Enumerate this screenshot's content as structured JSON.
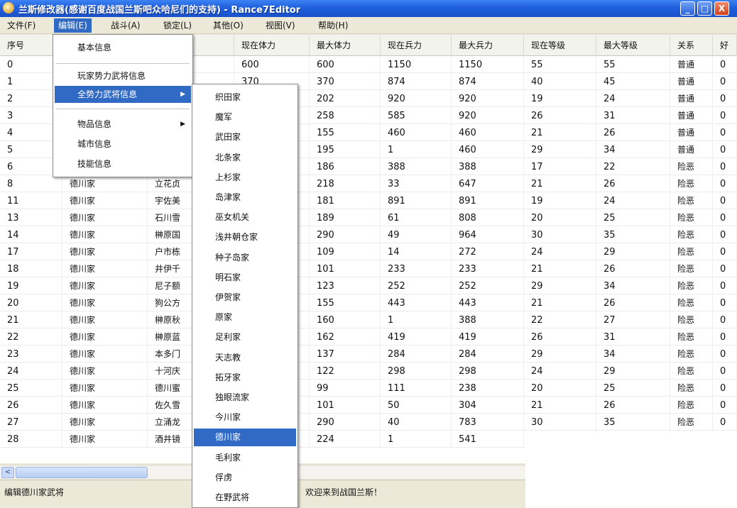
{
  "window": {
    "title": "兰斯修改器(感谢百度战国兰斯吧众哈尼们的支持) - Rance7Editor",
    "buttons": {
      "minimize": "_",
      "maximize": "□",
      "close": "X"
    }
  },
  "menubar": [
    "文件(F)",
    "编辑(E)",
    "战斗(A)",
    "锁定(L)",
    "其他(O)",
    "视图(V)",
    "帮助(H)"
  ],
  "table": {
    "headers": [
      "序号",
      "",
      "",
      "现在体力",
      "最大体力",
      "现在兵力",
      "最大兵力",
      "现在等级",
      "最大等级",
      "关系",
      "好"
    ],
    "rows": [
      [
        "0",
        "",
        "",
        "600",
        "600",
        "1150",
        "1150",
        "55",
        "55",
        "普通",
        "0"
      ],
      [
        "1",
        "",
        "",
        "370",
        "370",
        "874",
        "874",
        "40",
        "45",
        "普通",
        "0"
      ],
      [
        "2",
        "",
        "",
        "",
        "202",
        "920",
        "920",
        "19",
        "24",
        "普通",
        "0"
      ],
      [
        "3",
        "",
        "",
        "",
        "258",
        "585",
        "920",
        "26",
        "31",
        "普通",
        "0"
      ],
      [
        "4",
        "",
        "",
        "",
        "155",
        "460",
        "460",
        "21",
        "26",
        "普通",
        "0"
      ],
      [
        "5",
        "",
        "",
        "",
        "195",
        "1",
        "460",
        "29",
        "34",
        "普通",
        "0"
      ],
      [
        "6",
        "",
        "",
        "",
        "186",
        "388",
        "388",
        "17",
        "22",
        "险恶",
        "0"
      ],
      [
        "8",
        "德川家",
        "立花贞",
        "",
        "218",
        "33",
        "647",
        "21",
        "26",
        "险恶",
        "0"
      ],
      [
        "11",
        "德川家",
        "宇佐美",
        "",
        "181",
        "891",
        "891",
        "19",
        "24",
        "险恶",
        "0"
      ],
      [
        "13",
        "德川家",
        "石川雪",
        "",
        "189",
        "61",
        "808",
        "20",
        "25",
        "险恶",
        "0"
      ],
      [
        "14",
        "德川家",
        "榊原国",
        "",
        "290",
        "49",
        "964",
        "30",
        "35",
        "险恶",
        "0"
      ],
      [
        "17",
        "德川家",
        "户市栋",
        "",
        "109",
        "14",
        "272",
        "24",
        "29",
        "险恶",
        "0"
      ],
      [
        "18",
        "德川家",
        "井伊千",
        "",
        "101",
        "233",
        "233",
        "21",
        "26",
        "险恶",
        "0"
      ],
      [
        "19",
        "德川家",
        "尼子额",
        "",
        "123",
        "252",
        "252",
        "29",
        "34",
        "险恶",
        "0"
      ],
      [
        "20",
        "德川家",
        "狗公方",
        "",
        "155",
        "443",
        "443",
        "21",
        "26",
        "险恶",
        "0"
      ],
      [
        "21",
        "德川家",
        "榊原秋",
        "",
        "160",
        "1",
        "388",
        "22",
        "27",
        "险恶",
        "0"
      ],
      [
        "22",
        "德川家",
        "榊原蓝",
        "",
        "162",
        "419",
        "419",
        "26",
        "31",
        "险恶",
        "0"
      ],
      [
        "23",
        "德川家",
        "本多门",
        "",
        "137",
        "284",
        "284",
        "29",
        "34",
        "险恶",
        "0"
      ],
      [
        "24",
        "德川家",
        "十河庆",
        "",
        "122",
        "298",
        "298",
        "24",
        "29",
        "险恶",
        "0"
      ],
      [
        "25",
        "德川家",
        "德川蜜",
        "",
        "99",
        "111",
        "238",
        "20",
        "25",
        "险恶",
        "0"
      ],
      [
        "26",
        "德川家",
        "佐久雪",
        "",
        "101",
        "50",
        "304",
        "21",
        "26",
        "险恶",
        "0"
      ],
      [
        "27",
        "德川家",
        "立涌龙",
        "",
        "290",
        "40",
        "783",
        "30",
        "35",
        "险恶",
        "0"
      ],
      [
        "28",
        "德川家",
        "酒井镜",
        "",
        "224",
        "1",
        "541",
        "",
        "",
        "",
        ""
      ]
    ]
  },
  "edit_menu": {
    "items": [
      "基本信息",
      "玩家势力武将信息",
      "全势力武将信息",
      "物品信息",
      "城市信息",
      "技能信息"
    ]
  },
  "submenu": {
    "items": [
      "织田家",
      "魔军",
      "武田家",
      "北条家",
      "上杉家",
      "岛津家",
      "巫女机关",
      "浅井朝仓家",
      "种子岛家",
      "明石家",
      "伊贺家",
      "原家",
      "足利家",
      "天志教",
      "拓牙家",
      "独眼流家",
      "今川家",
      "德川家",
      "毛利家",
      "俘虏",
      "在野武将"
    ],
    "highlighted": "德川家"
  },
  "statusbar": {
    "left": "编辑德川家武将",
    "right": "欢迎来到战国兰斯！"
  },
  "scrollbar": {
    "left_arrow": "<"
  },
  "colors": {
    "highlight": "#316ac5",
    "titlebar": "#1f5fdc"
  }
}
